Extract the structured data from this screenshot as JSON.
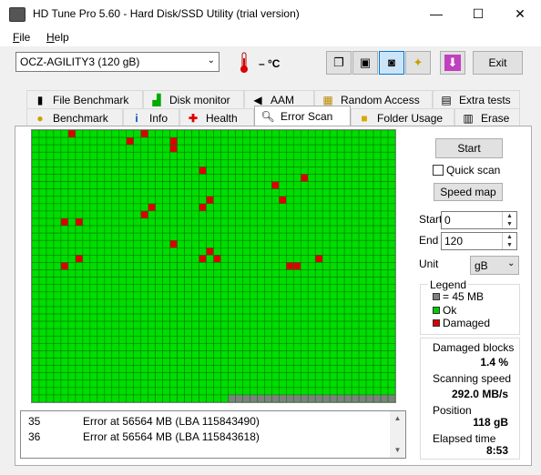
{
  "window": {
    "title": "HD Tune Pro 5.60 - Hard Disk/SSD Utility (trial version)",
    "controls": [
      "—",
      "☐",
      "✕"
    ]
  },
  "menu": [
    {
      "label": "File"
    },
    {
      "label": "Help"
    }
  ],
  "toolbar": {
    "drive": "OCZ-AGILITY3 (120 gB)",
    "temperature": "– °C",
    "exit_label": "Exit"
  },
  "tabs_row1": [
    "File Benchmark",
    "Disk monitor",
    "AAM",
    "Random Access",
    "Extra tests"
  ],
  "tabs_row2": [
    "Benchmark",
    "Info",
    "Health",
    "Error Scan",
    "Folder Usage",
    "Erase"
  ],
  "active_tab": "Error Scan",
  "controls": {
    "start_label": "Start",
    "quick_scan_label": "Quick scan",
    "speed_map_label": "Speed map",
    "start_field_label": "Start",
    "start_value": "0",
    "end_field_label": "End",
    "end_value": "120",
    "unit_label": "Unit",
    "unit_value": "gB"
  },
  "legend": {
    "title": "Legend",
    "items": [
      {
        "label": "= 45 MB",
        "color": "#808080"
      },
      {
        "label": "Ok",
        "color": "#00cc00"
      },
      {
        "label": "Damaged",
        "color": "#dd0000"
      }
    ]
  },
  "stats": {
    "damaged_blocks_label": "Damaged blocks",
    "damaged_blocks_value": "1.4 %",
    "scanning_speed_label": "Scanning speed",
    "scanning_speed_value": "292.0 MB/s",
    "position_label": "Position",
    "position_value": "118 gB",
    "elapsed_time_label": "Elapsed time",
    "elapsed_time_value": "8:53"
  },
  "log": [
    {
      "n": "35",
      "msg": "Error at 56564 MB (LBA 115843490)"
    },
    {
      "n": "36",
      "msg": "Error at 56564 MB (LBA 115843618)"
    }
  ],
  "block_map": {
    "columns": 50,
    "rows": 37,
    "colors": {
      "ok": "#00dd00",
      "damaged": "#dd0000",
      "unscanned": "#808080",
      "grid": "#008000"
    },
    "damaged": [
      [
        0,
        5
      ],
      [
        0,
        15
      ],
      [
        1,
        13
      ],
      [
        1,
        19
      ],
      [
        2,
        19
      ],
      [
        5,
        23
      ],
      [
        6,
        37
      ],
      [
        7,
        33
      ],
      [
        9,
        24
      ],
      [
        9,
        34
      ],
      [
        10,
        16
      ],
      [
        10,
        23
      ],
      [
        11,
        15
      ],
      [
        12,
        4
      ],
      [
        12,
        6
      ],
      [
        15,
        19
      ],
      [
        16,
        24
      ],
      [
        17,
        23
      ],
      [
        17,
        25
      ],
      [
        17,
        6
      ],
      [
        18,
        4
      ],
      [
        18,
        35
      ],
      [
        18,
        36
      ],
      [
        17,
        39
      ]
    ],
    "unscanned_last_row_from_col": 27
  }
}
